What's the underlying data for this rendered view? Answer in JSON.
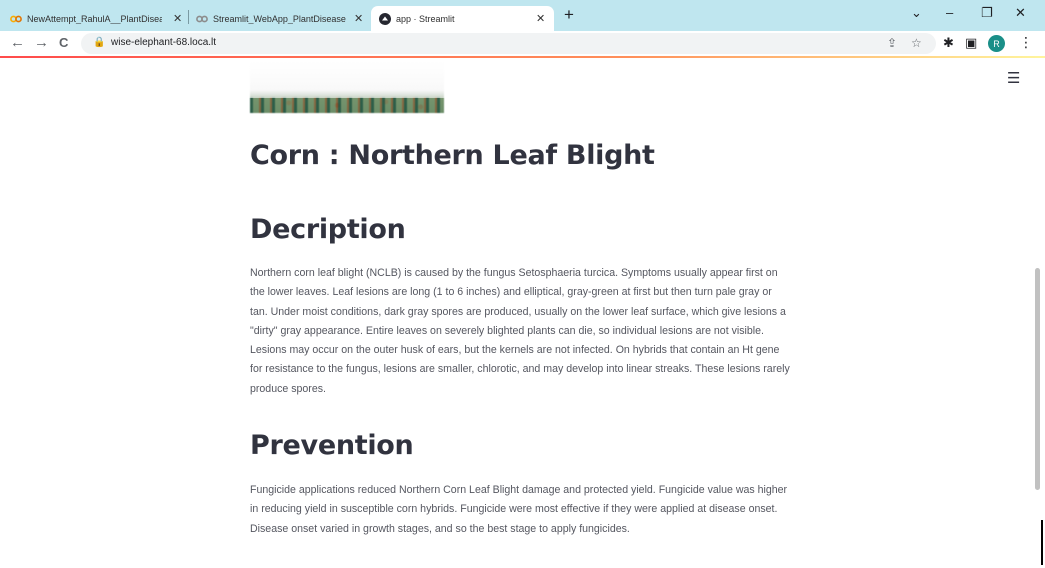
{
  "browser": {
    "tabs": [
      {
        "title": "NewAttempt_RahulA__PlantDisea",
        "icon": "colab-icon",
        "active": false
      },
      {
        "title": "Streamlit_WebApp_PlantDisease",
        "icon": "colab-icon",
        "active": false
      },
      {
        "title": "app · Streamlit",
        "icon": "streamlit-icon",
        "active": true
      }
    ],
    "url": "wise-elephant-68.loca.lt",
    "profile_initial": "R"
  },
  "page": {
    "title": "Corn : Northern Leaf Blight",
    "description_heading": "Decription",
    "description_text": "Northern corn leaf blight (NCLB) is caused by the fungus Setosphaeria turcica. Symptoms usually appear first on the lower leaves. Leaf lesions are long (1 to 6 inches) and elliptical, gray-green at first but then turn pale gray or tan. Under moist conditions, dark gray spores are produced, usually on the lower leaf surface, which give lesions a \"dirty\" gray appearance. Entire leaves on severely blighted plants can die, so individual lesions are not visible. Lesions may occur on the outer husk of ears, but the kernels are not infected. On hybrids that contain an Ht gene for resistance to the fungus, lesions are smaller, chlorotic, and may develop into linear streaks. These lesions rarely produce spores.",
    "prevention_heading": "Prevention",
    "prevention_text": "Fungicide applications reduced Northern Corn Leaf Blight damage and protected yield. Fungicide value was higher in reducing yield in susceptible corn hybrids. Fungicide were most effective if they were applied at disease onset. Disease onset varied in growth stages, and so the best stage to apply fungicides."
  },
  "colors": {
    "tabbar": "#bfe6ef",
    "text": "#31333f",
    "accent": "#ff4b4b"
  }
}
